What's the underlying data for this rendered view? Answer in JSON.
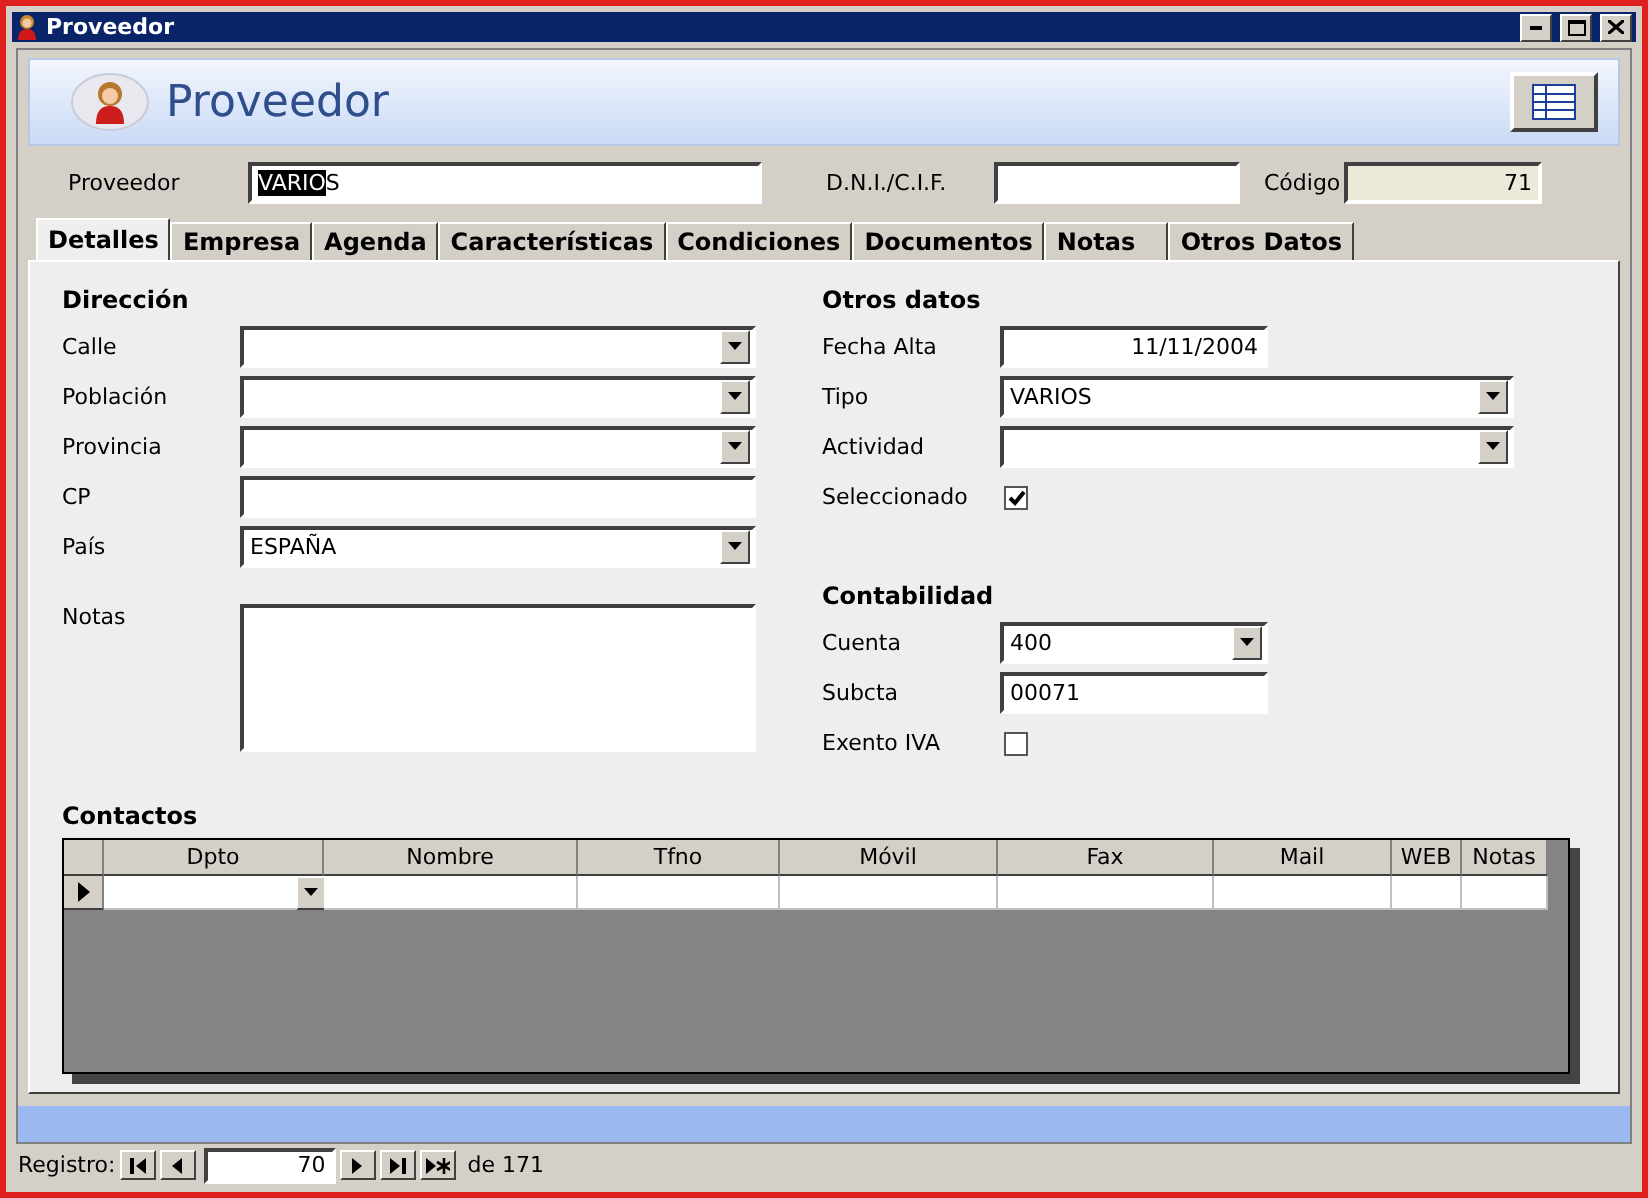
{
  "window": {
    "title": "Proveedor"
  },
  "header": {
    "title": "Proveedor"
  },
  "top_fields": [
    {
      "label": "Proveedor",
      "value": "VARIOS",
      "kind": "text"
    },
    {
      "label": "D.N.I./C.I.F.",
      "kind": "text"
    },
    {
      "label": "Código",
      "value": "71",
      "kind": "readonly"
    }
  ],
  "tabs": [
    {
      "label": "Detalles",
      "selected": true
    },
    {
      "label": "Empresa",
      "selected": false
    },
    {
      "label": "Agenda",
      "selected": false
    },
    {
      "label": "Características",
      "selected": false
    },
    {
      "label": "Condiciones",
      "selected": false
    },
    {
      "label": "Documentos",
      "selected": false
    },
    {
      "label": "Notas",
      "selected": false
    },
    {
      "label": "Otros Datos",
      "selected": false
    }
  ],
  "address": {
    "title": "Dirección",
    "fields": [
      {
        "label": "Calle",
        "kind": "combo"
      },
      {
        "label": "Población",
        "kind": "combo"
      },
      {
        "label": "Provincia",
        "kind": "combo"
      },
      {
        "label": "CP",
        "kind": "text"
      },
      {
        "label": "País",
        "kind": "combo",
        "value": "ESPAÑA"
      }
    ],
    "notes": {
      "label": "Notas"
    }
  },
  "right_sections": [
    {
      "title": "Otros datos",
      "fields": [
        {
          "label": "Fecha Alta",
          "kind": "date",
          "value": "11/11/2004"
        },
        {
          "label": "Tipo",
          "kind": "combo",
          "value": "VARIOS"
        },
        {
          "label": "Actividad",
          "kind": "combo"
        },
        {
          "label": "Seleccionado",
          "kind": "checkbox",
          "checked": true
        }
      ]
    },
    {
      "title": "Contabilidad",
      "fields": [
        {
          "label": "Cuenta",
          "kind": "combo",
          "value": "400"
        },
        {
          "label": "Subcta",
          "kind": "text",
          "value": "00071"
        },
        {
          "label": "Exento IVA",
          "kind": "checkbox",
          "checked": false
        }
      ]
    }
  ],
  "contacts": {
    "title": "Contactos",
    "columns": [
      {
        "label": "Dpto",
        "kind": "combo"
      },
      {
        "label": "Nombre",
        "kind": "text"
      },
      {
        "label": "Tfno",
        "kind": "text"
      },
      {
        "label": "Móvil",
        "kind": "text"
      },
      {
        "label": "Fax",
        "kind": "text"
      },
      {
        "label": "Mail",
        "kind": "text"
      },
      {
        "label": "WEB",
        "kind": "text"
      },
      {
        "label": "Notas",
        "kind": "text"
      }
    ],
    "rows": [
      {
        "current": true
      }
    ]
  },
  "navigator": {
    "label": "Registro:",
    "current": "70",
    "of": "de",
    "total": "171"
  }
}
